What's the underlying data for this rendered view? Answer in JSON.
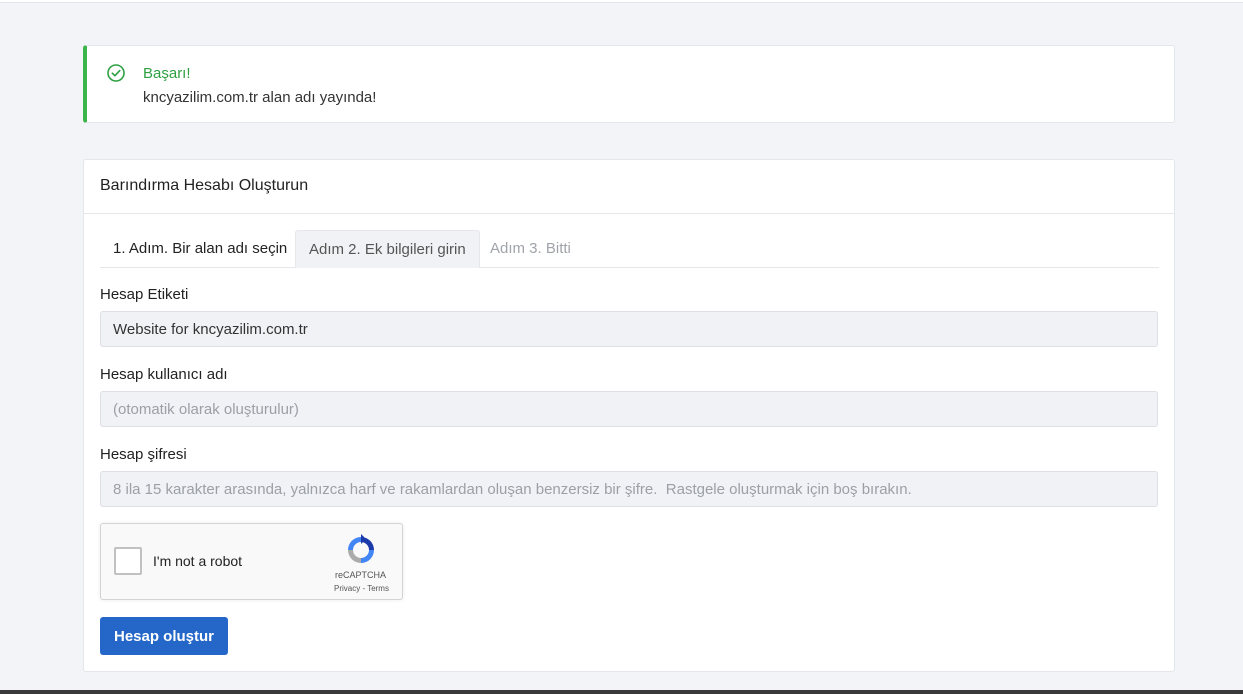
{
  "alert": {
    "title": "Başarı!",
    "message": "kncyazilim.com.tr alan adı yayında!",
    "color": "#3bb44a"
  },
  "card": {
    "title": "Barındırma Hesabı Oluşturun",
    "tabs": [
      {
        "label": "1. Adım. Bir alan adı seçin",
        "state": "done"
      },
      {
        "label": "Adım 2. Ek bilgileri girin",
        "state": "active"
      },
      {
        "label": "Adım 3. Bitti",
        "state": "disabled"
      }
    ],
    "fields": {
      "label_field": {
        "label": "Hesap Etiketi",
        "value": "Website for kncyazilim.com.tr",
        "placeholder": ""
      },
      "username_field": {
        "label": "Hesap kullanıcı adı",
        "value": "",
        "placeholder": "(otomatik olarak oluşturulur)"
      },
      "password_field": {
        "label": "Hesap şifresi",
        "value": "",
        "placeholder": "8 ila 15 karakter arasında, yalnızca harf ve rakamlardan oluşan benzersiz bir şifre.  Rastgele oluşturmak için boş bırakın."
      }
    },
    "recaptcha": {
      "label": "I'm not a robot",
      "brand": "reCAPTCHA",
      "terms": "Privacy - Terms",
      "checked": false
    },
    "submit_label": "Hesap oluştur",
    "accent_color": "#2467c8"
  }
}
